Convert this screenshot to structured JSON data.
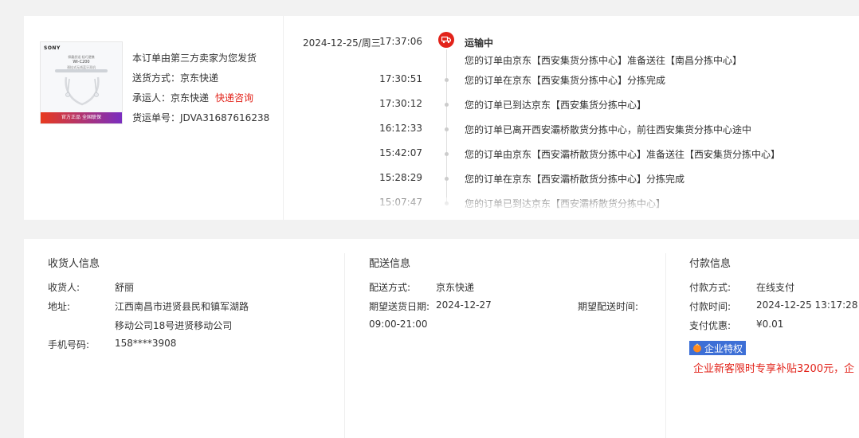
{
  "product": {
    "image": {
      "brand": "SONY",
      "line1": "佩戴舒适 轻巧便携",
      "model": "WI-C200",
      "line3": "颈挂式无线蓝牙耳机",
      "banner": "官方正品  全国联保"
    },
    "seller_note": "本订单由第三方卖家为您发货",
    "shipping_method_label": "送货方式：",
    "shipping_method_value": "京东快递",
    "carrier_label": "承运人：",
    "carrier_value": "京东快递",
    "carrier_link": "快递咨询",
    "tracking_label": "货运单号：",
    "tracking_value": "JDVA31687616238"
  },
  "timeline": {
    "date": "2024-12-25/周三",
    "status": "运输中",
    "events": [
      {
        "time": "17:37:06",
        "text": "您的订单由京东【西安集货分拣中心】准备送往【南昌分拣中心】"
      },
      {
        "time": "17:30:51",
        "text": "您的订单在京东【西安集货分拣中心】分拣完成"
      },
      {
        "time": "17:30:12",
        "text": "您的订单已到达京东【西安集货分拣中心】"
      },
      {
        "time": "16:12:33",
        "text": "您的订单已离开西安灞桥散货分拣中心，前往西安集货分拣中心途中"
      },
      {
        "time": "15:42:07",
        "text": "您的订单由京东【西安灞桥散货分拣中心】准备送往【西安集货分拣中心】"
      },
      {
        "time": "15:28:29",
        "text": "您的订单在京东【西安灞桥散货分拣中心】分拣完成"
      },
      {
        "time": "15:07:47",
        "text": "您的订单已到达京东【西安灞桥散货分拣中心】"
      }
    ]
  },
  "receiver": {
    "title": "收货人信息",
    "name_label": "收货人:",
    "name_value": "舒丽",
    "address_label": "地址:",
    "address_line1": "江西南昌市进贤县民和镇军湖路",
    "address_line2": "移动公司18号进贤移动公司",
    "phone_label": "手机号码:",
    "phone_value": "158****3908"
  },
  "delivery": {
    "title": "配送信息",
    "method_label": "配送方式:",
    "method_value": "京东快递",
    "date_label": "期望送货日期:",
    "date_value": "2024-12-27",
    "time_window": "09:00-21:00",
    "expected_time_label": "期望配送时间:"
  },
  "payment": {
    "title": "付款信息",
    "method_label": "付款方式:",
    "method_value": "在线支付",
    "time_label": "付款时间:",
    "time_value": "2024-12-25 13:17:28",
    "discount_label": "支付优惠:",
    "discount_value": "¥0.01",
    "enterprise_badge": "企业特权",
    "enterprise_promo": "企业新客限时专享补贴3200元，企"
  },
  "colors": {
    "accent_red": "#e2231a",
    "badge_blue": "#3d6fd6"
  }
}
